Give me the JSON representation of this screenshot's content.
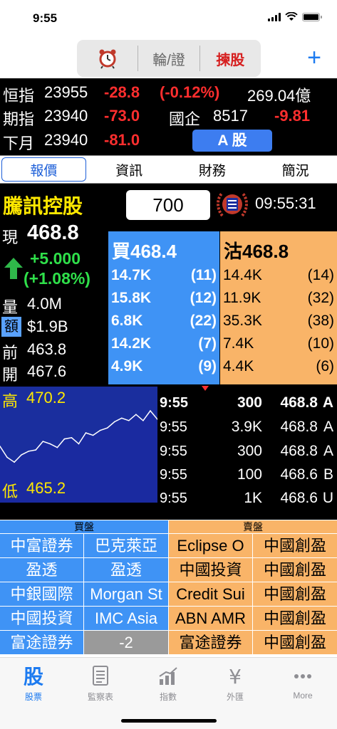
{
  "status_bar": {
    "time": "9:55"
  },
  "toolbar": {
    "alarm_icon": "alarm-clock-icon",
    "segment_warrant": "輪/證",
    "segment_pick": "揀股",
    "add_label": "+"
  },
  "indices": {
    "hsi": {
      "label": "恒指",
      "value": "23955",
      "change": "-28.8",
      "change_pct": "(-0.12%)",
      "turnover": "269.04億"
    },
    "futures": {
      "label": "期指",
      "value": "23940",
      "change": "-73.0",
      "hscei_label": "國企",
      "hscei_value": "8517",
      "hscei_change": "-9.81"
    },
    "next_month": {
      "label": "下月",
      "value": "23940",
      "change": "-81.0"
    },
    "a_share_button": "A 股"
  },
  "tabs": [
    {
      "label": "報價",
      "active": true
    },
    {
      "label": "資訊",
      "active": false
    },
    {
      "label": "財務",
      "active": false
    },
    {
      "label": "簡況",
      "active": false
    }
  ],
  "quote": {
    "name": "騰訊控股",
    "code": "700",
    "time": "09:55:31",
    "current_label": "現",
    "current_price": "468.8",
    "change": "+5.000",
    "change_pct": "(+1.08%)",
    "volume_label": "量",
    "volume": "4.0M",
    "amount_label": "額",
    "amount": "$1.9B",
    "prev_close_label": "前",
    "prev_close": "463.8",
    "open_label": "開",
    "open": "467.6"
  },
  "order_book": {
    "bid_label": "買",
    "bid_price": "468.4",
    "ask_label": "沽",
    "ask_price": "468.8",
    "bids": [
      {
        "qty": "14.7K",
        "count": "(11)"
      },
      {
        "qty": "15.8K",
        "count": "(12)"
      },
      {
        "qty": "6.8K",
        "count": "(22)"
      },
      {
        "qty": "14.2K",
        "count": "(7)"
      },
      {
        "qty": "4.9K",
        "count": "(9)"
      }
    ],
    "asks": [
      {
        "qty": "14.4K",
        "count": "(14)"
      },
      {
        "qty": "11.9K",
        "count": "(32)"
      },
      {
        "qty": "35.3K",
        "count": "(38)"
      },
      {
        "qty": "7.4K",
        "count": "(10)"
      },
      {
        "qty": "4.4K",
        "count": "(6)"
      }
    ]
  },
  "chart": {
    "high_label": "高",
    "high": "470.2",
    "low_label": "低",
    "low": "465.2"
  },
  "chart_data": {
    "type": "line",
    "series": [
      {
        "values": [
          467.3,
          466.4,
          466.0,
          466.6,
          466.9,
          467.0,
          467.7,
          467.5,
          467.2,
          467.9,
          468.0,
          467.5,
          468.4,
          468.2,
          468.6,
          468.8,
          469.3,
          469.6,
          469.4,
          469.9,
          469.4,
          470.2,
          469.5
        ]
      }
    ],
    "ylim": [
      465.2,
      470.2
    ],
    "title": "",
    "xlabel": "",
    "ylabel": ""
  },
  "trades": [
    {
      "time": "9:55",
      "volume": "300",
      "price": "468.8",
      "side": "A"
    },
    {
      "time": "9:55",
      "volume": "3.9K",
      "price": "468.8",
      "side": "A"
    },
    {
      "time": "9:55",
      "volume": "300",
      "price": "468.8",
      "side": "A"
    },
    {
      "time": "9:55",
      "volume": "100",
      "price": "468.6",
      "side": "B"
    },
    {
      "time": "9:55",
      "volume": "1K",
      "price": "468.6",
      "side": "U"
    }
  ],
  "brokers": {
    "buy_header": "買盤",
    "sell_header": "賣盤",
    "buy": [
      [
        "中富證券",
        "巴克萊亞"
      ],
      [
        "盈透",
        "盈透"
      ],
      [
        "中銀國際",
        "Morgan St"
      ],
      [
        "中國投資",
        "IMC Asia"
      ],
      [
        "富途證券",
        "-2"
      ]
    ],
    "sell": [
      [
        "Eclipse O",
        "中國創盈"
      ],
      [
        "中國投資",
        "中國創盈"
      ],
      [
        "Credit Sui",
        "中國創盈"
      ],
      [
        "ABN AMR",
        "中國創盈"
      ],
      [
        "富途證券",
        "中國創盈"
      ]
    ]
  },
  "tab_bar": [
    {
      "label": "股票",
      "icon": "stock-icon",
      "active": true
    },
    {
      "label": "監察表",
      "icon": "watchlist-icon",
      "active": false
    },
    {
      "label": "指數",
      "icon": "index-chart-icon",
      "active": false
    },
    {
      "label": "外匯",
      "icon": "forex-yen-icon",
      "active": false
    },
    {
      "label": "More",
      "icon": "more-dots-icon",
      "active": false
    }
  ],
  "colors": {
    "bid_blue": "#3f93f5",
    "ask_orange": "#f9b468",
    "up_green": "#2fe04a",
    "down_red": "#ff2e2e",
    "name_yellow": "#ffe800",
    "accent_blue": "#1d7bf0"
  }
}
